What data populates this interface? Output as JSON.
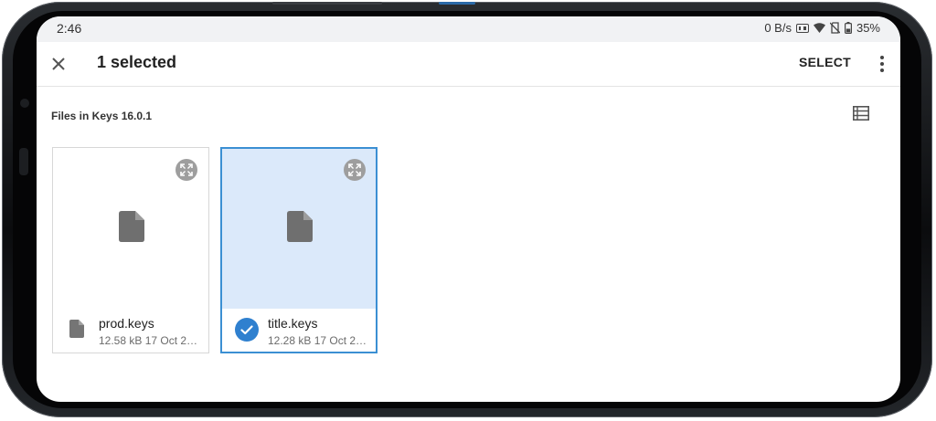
{
  "status_bar": {
    "time": "2:46",
    "speed": "0 B/s",
    "battery": "35%"
  },
  "appbar": {
    "title": "1 selected",
    "select_label": "SELECT"
  },
  "section": {
    "title": "Files in Keys 16.0.1"
  },
  "files": [
    {
      "name": "prod.keys",
      "info": "12.58 kB 17 Oct 2…",
      "selected": false
    },
    {
      "name": "title.keys",
      "info": "12.28 kB 17 Oct 2…",
      "selected": true
    }
  ],
  "colors": {
    "accent": "#2f80cf",
    "selected_bg": "#dbe9fa",
    "icon_gray": "#757575"
  }
}
